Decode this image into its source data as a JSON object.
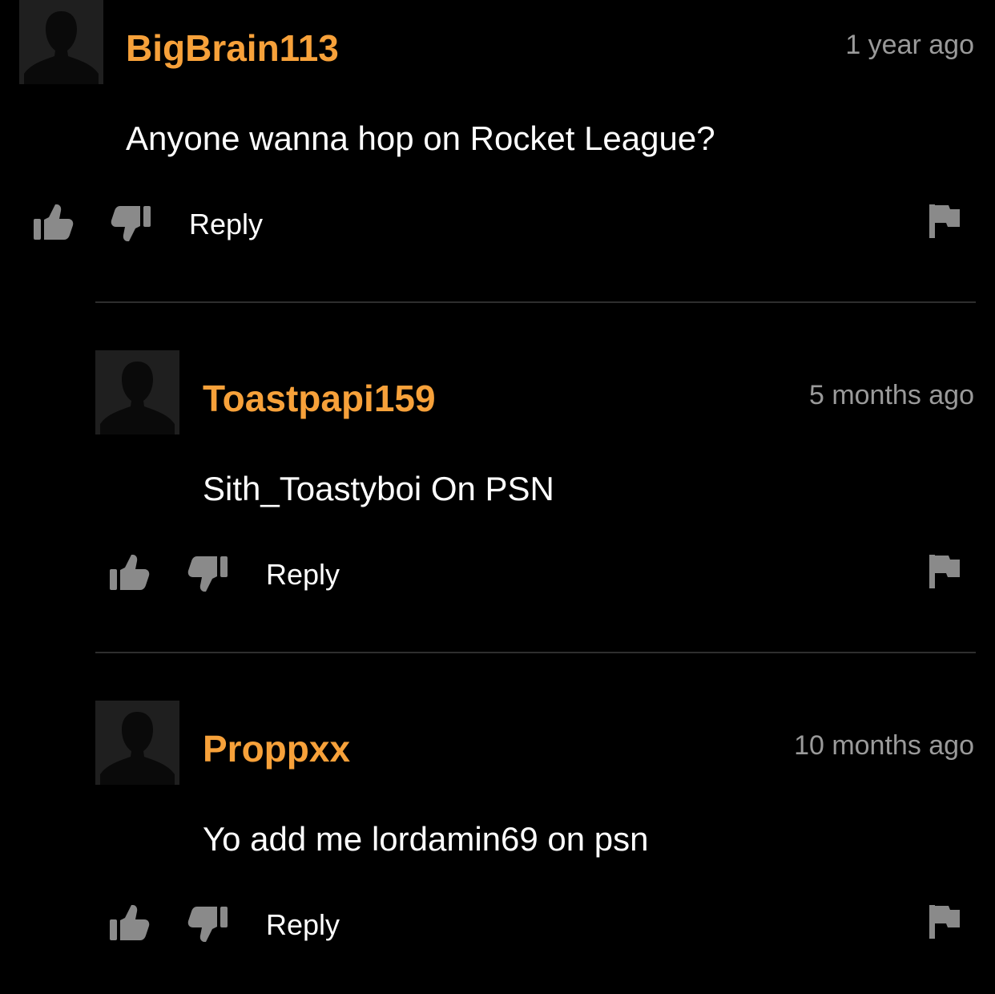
{
  "comments": [
    {
      "username": "BigBrain113",
      "timestamp": "1 year ago",
      "text": "Anyone wanna hop on Rocket League?",
      "reply_label": "Reply",
      "icons": [
        "avatar-placeholder-icon",
        "thumbs-up-icon",
        "thumbs-down-icon",
        "flag-icon"
      ]
    },
    {
      "username": "Toastpapi159",
      "timestamp": "5 months ago",
      "text": "Sith_Toastyboi On PSN",
      "reply_label": "Reply",
      "icons": [
        "avatar-placeholder-icon",
        "thumbs-up-icon",
        "thumbs-down-icon",
        "flag-icon"
      ]
    },
    {
      "username": "Proppxx",
      "timestamp": "10 months ago",
      "text": "Yo add me lordamin69 on psn",
      "reply_label": "Reply",
      "icons": [
        "avatar-placeholder-icon",
        "thumbs-up-icon",
        "thumbs-down-icon",
        "flag-icon"
      ]
    }
  ],
  "colors": {
    "background": "#000000",
    "username": "#f7a13a",
    "timestamp": "#9a9a9a",
    "text": "#ffffff",
    "icon": "#8a8a8a",
    "divider": "#2e2e2e",
    "avatar_bg": "#1f1f1f",
    "avatar_silhouette": "#0a0a0a"
  }
}
